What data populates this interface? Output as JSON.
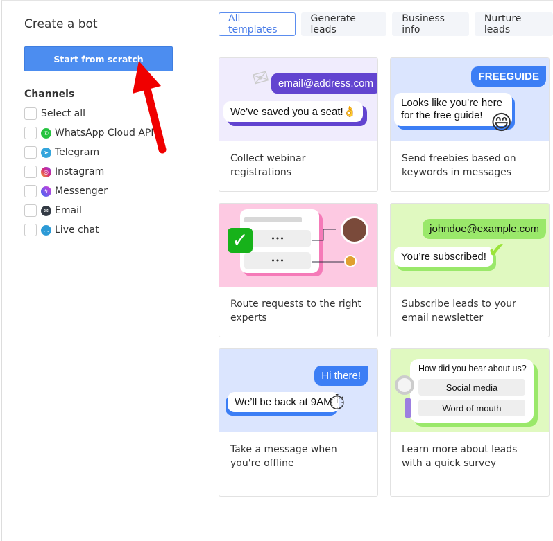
{
  "sidebar": {
    "title": "Create a bot",
    "start_button": "Start from scratch",
    "channels_heading": "Channels",
    "channels": [
      {
        "label": "Select all"
      },
      {
        "label": "WhatsApp Cloud API",
        "icon": "whatsapp-icon",
        "color": "#25c33f"
      },
      {
        "label": "Telegram",
        "icon": "telegram-icon",
        "color": "#34a5dc"
      },
      {
        "label": "Instagram",
        "icon": "instagram-icon",
        "color": "#d6297a"
      },
      {
        "label": "Messenger",
        "icon": "messenger-icon",
        "color": "#8a3cf0"
      },
      {
        "label": "Email",
        "icon": "email-icon",
        "color": "#333a44"
      },
      {
        "label": "Live chat",
        "icon": "live-chat-icon",
        "color": "#2c9ad6"
      }
    ]
  },
  "tabs": [
    {
      "label": "All templates",
      "active": true
    },
    {
      "label": "Generate leads"
    },
    {
      "label": "Business info"
    },
    {
      "label": "Nurture leads"
    }
  ],
  "templates": [
    {
      "caption": "Collect webinar registrations",
      "bubbles": [
        "email@address.com",
        "We've saved you a seat!👌"
      ]
    },
    {
      "caption": "Send freebies based on keywords in messages",
      "bubbles": [
        "FREEGUIDE",
        "Looks like you’re here for the free guide!"
      ]
    },
    {
      "caption": "Route requests to the right experts",
      "bubbles": [
        "•••",
        "•••"
      ]
    },
    {
      "caption": "Subscribe leads to your email newsletter",
      "bubbles": [
        "johndoe@example.com",
        "You’re subscribed!"
      ]
    },
    {
      "caption": "Take a message when you're offline",
      "bubbles": [
        "Hi there!",
        "We’ll be back at 9AM"
      ]
    },
    {
      "caption": "Learn more about leads with a quick survey",
      "bubbles": [
        "How did you hear about us?",
        "Social media",
        "Word of mouth"
      ]
    }
  ],
  "colors": {
    "accent": "#4c8df0",
    "arrow": "#f00000"
  }
}
